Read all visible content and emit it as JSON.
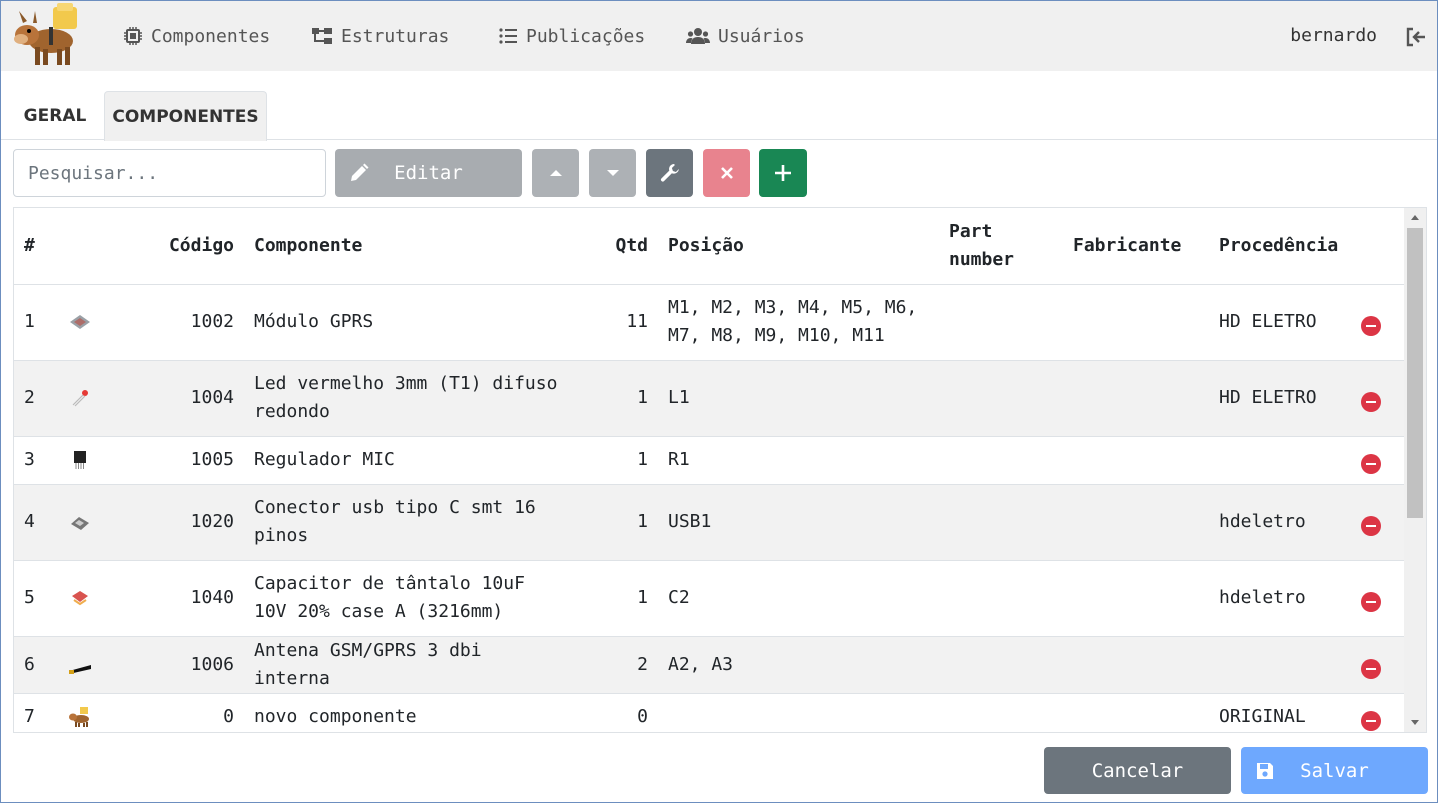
{
  "nav": {
    "items": [
      {
        "label": "Componentes",
        "icon": "chip-icon"
      },
      {
        "label": "Estruturas",
        "icon": "sitemap-icon"
      },
      {
        "label": "Publicações",
        "icon": "list-icon"
      },
      {
        "label": "Usuários",
        "icon": "users-icon"
      }
    ],
    "user": "bernardo"
  },
  "tabs": [
    {
      "label": "GERAL",
      "active": false
    },
    {
      "label": "COMPONENTES",
      "active": true
    }
  ],
  "toolbar": {
    "search_placeholder": "Pesquisar...",
    "edit_label": "Editar"
  },
  "table": {
    "headers": {
      "num": "#",
      "codigo": "Código",
      "componente": "Componente",
      "qtd": "Qtd",
      "posicao": "Posição",
      "part_number_1": "Part",
      "part_number_2": "number",
      "fabricante": "Fabricante",
      "procedencia": "Procedência"
    },
    "rows": [
      {
        "n": "1",
        "codigo": "1002",
        "componente": "Módulo GPRS",
        "qtd": "11",
        "posicao": "M1, M2, M3, M4, M5, M6, M7, M8, M9, M10, M11",
        "part_number": "",
        "fabricante": "",
        "procedencia": "HD ELETRO",
        "thumb": "module-icon"
      },
      {
        "n": "2",
        "codigo": "1004",
        "componente": "Led vermelho 3mm (T1) difuso redondo",
        "qtd": "1",
        "posicao": "L1",
        "part_number": "",
        "fabricante": "",
        "procedencia": "HD ELETRO",
        "thumb": "led-icon"
      },
      {
        "n": "3",
        "codigo": "1005",
        "componente": "Regulador MIC",
        "qtd": "1",
        "posicao": "R1",
        "part_number": "",
        "fabricante": "",
        "procedencia": "",
        "thumb": "regulator-icon"
      },
      {
        "n": "4",
        "codigo": "1020",
        "componente": "Conector usb tipo C smt 16 pinos",
        "qtd": "1",
        "posicao": "USB1",
        "part_number": "",
        "fabricante": "",
        "procedencia": "hdeletro",
        "thumb": "usb-connector-icon"
      },
      {
        "n": "5",
        "codigo": "1040",
        "componente": "Capacitor de tântalo 10uF 10V 20% case A (3216mm)",
        "qtd": "1",
        "posicao": "C2",
        "part_number": "",
        "fabricante": "",
        "procedencia": "hdeletro",
        "thumb": "capacitor-icon"
      },
      {
        "n": "6",
        "codigo": "1006",
        "componente": "Antena GSM/GPRS 3 dbi interna",
        "qtd": "2",
        "posicao": "A2, A3",
        "part_number": "",
        "fabricante": "",
        "procedencia": "",
        "thumb": "antenna-icon"
      },
      {
        "n": "7",
        "codigo": "0",
        "componente": "novo componente",
        "qtd": "0",
        "posicao": "",
        "part_number": "",
        "fabricante": "",
        "procedencia": "ORIGINAL",
        "thumb": "donkey-logo-icon"
      }
    ]
  },
  "footer": {
    "cancel_label": "Cancelar",
    "save_label": "Salvar"
  },
  "colors": {
    "topbar": "#f0f0f0",
    "edit_button": "#a8acb0",
    "arrow_buttons": "#adb1b5",
    "wrench_button": "#6c757d",
    "delete_button": "#e8838e",
    "add_button": "#198754",
    "cancel_button": "#6c757d",
    "save_button": "#6ea8fe",
    "row_delete": "#dc3545"
  }
}
